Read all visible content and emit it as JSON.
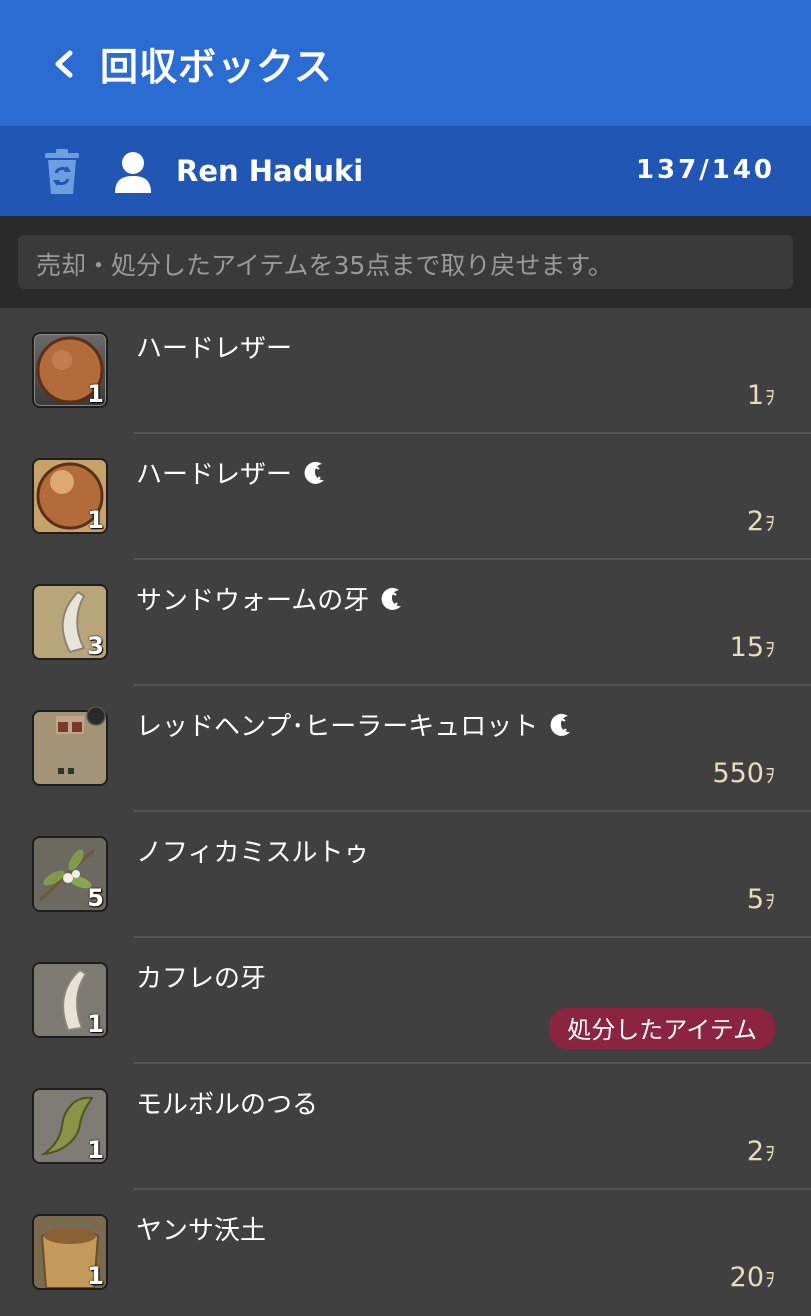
{
  "header": {
    "title": "回収ボックス"
  },
  "user": {
    "name": "Ren Haduki",
    "capacity": "137/140"
  },
  "notice": "売却・処分したアイテムを35点まで取り戻せます。",
  "currency": "ｦ",
  "items": [
    {
      "name": "ハードレザー",
      "hq": false,
      "qty": "1",
      "price": "1",
      "icon": "leather-icon",
      "disposed": false
    },
    {
      "name": "ハードレザー",
      "hq": true,
      "qty": "1",
      "price": "2",
      "icon": "leather-icon",
      "disposed": false
    },
    {
      "name": "サンドウォームの牙",
      "hq": true,
      "qty": "3",
      "price": "15",
      "icon": "fang-icon",
      "disposed": false
    },
    {
      "name": "レッドヘンプ･ヒーラーキュロット",
      "hq": true,
      "qty": "",
      "price": "550",
      "icon": "culottes-icon",
      "disposed": false
    },
    {
      "name": "ノフィカミスルトゥ",
      "hq": false,
      "qty": "5",
      "price": "5",
      "icon": "mistletoe-icon",
      "disposed": false
    },
    {
      "name": "カフレの牙",
      "hq": false,
      "qty": "1",
      "price": "",
      "icon": "fang-icon",
      "disposed": true
    },
    {
      "name": "モルボルのつる",
      "hq": false,
      "qty": "1",
      "price": "2",
      "icon": "vine-icon",
      "disposed": false
    },
    {
      "name": "ヤンサ沃土",
      "hq": false,
      "qty": "1",
      "price": "20",
      "icon": "soil-icon",
      "disposed": false
    }
  ],
  "disposed_label": "処分したアイテム",
  "colors": {
    "appbar": "#2b6cd2",
    "userbar": "#2256b4",
    "badge": "#8b2440",
    "price": "#e8dcc0"
  }
}
